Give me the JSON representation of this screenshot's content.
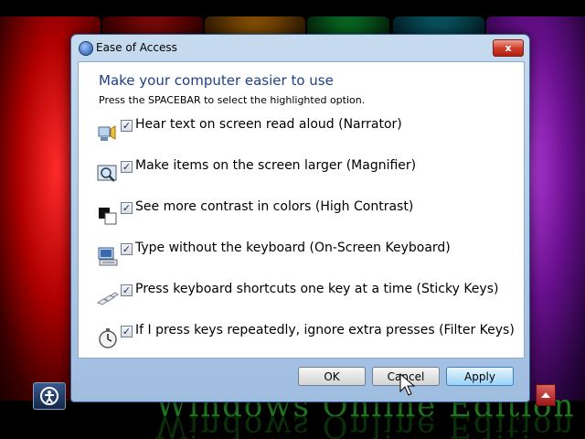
{
  "desktop": {
    "watermark": "Windows Online Edition"
  },
  "dialog": {
    "title": "Ease of Access",
    "close_label": "x",
    "heading": "Make your computer easier to use",
    "instruction": "Press the SPACEBAR to select the highlighted option.",
    "options": [
      {
        "label": "Hear text on screen read aloud (Narrator)",
        "icon": "narrator-icon",
        "checked": true
      },
      {
        "label": "Make items on the screen larger (Magnifier)",
        "icon": "magnifier-icon",
        "checked": true
      },
      {
        "label": "See more contrast in colors (High Contrast)",
        "icon": "high-contrast-icon",
        "checked": true
      },
      {
        "label": "Type without the keyboard (On-Screen Keyboard)",
        "icon": "on-screen-keyboard-icon",
        "checked": true
      },
      {
        "label": "Press keyboard shortcuts one key at a time (Sticky Keys)",
        "icon": "sticky-keys-icon",
        "checked": true
      },
      {
        "label": "If I press keys repeatedly, ignore extra presses (Filter Keys)",
        "icon": "filter-keys-icon",
        "checked": true
      }
    ],
    "check_mark": "✓",
    "buttons": {
      "ok": "OK",
      "cancel": "Cancel",
      "apply": "Apply"
    }
  },
  "colors": {
    "heading": "#1e3f8a",
    "dialog_frame": "#c7dbef",
    "close_button": "#d04030"
  }
}
